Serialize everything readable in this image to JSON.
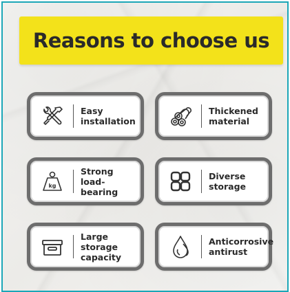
{
  "banner": {
    "title": "Reasons to choose us",
    "color": "#f3e21a"
  },
  "frame_color": "#1aa6b7",
  "features": [
    {
      "icon": "tools-icon",
      "label": "Easy\ninstallation"
    },
    {
      "icon": "pipes-icon",
      "label": "Thickened\nmaterial"
    },
    {
      "icon": "weight-kg-icon",
      "label": "Strong\nload-bearing",
      "icon_text": "kg"
    },
    {
      "icon": "grid-icon",
      "label": "Diverse\nstorage"
    },
    {
      "icon": "storage-box-icon",
      "label": "Large storage\ncapacity"
    },
    {
      "icon": "droplet-icon",
      "label": "Anticorrosive\nantirust"
    }
  ]
}
